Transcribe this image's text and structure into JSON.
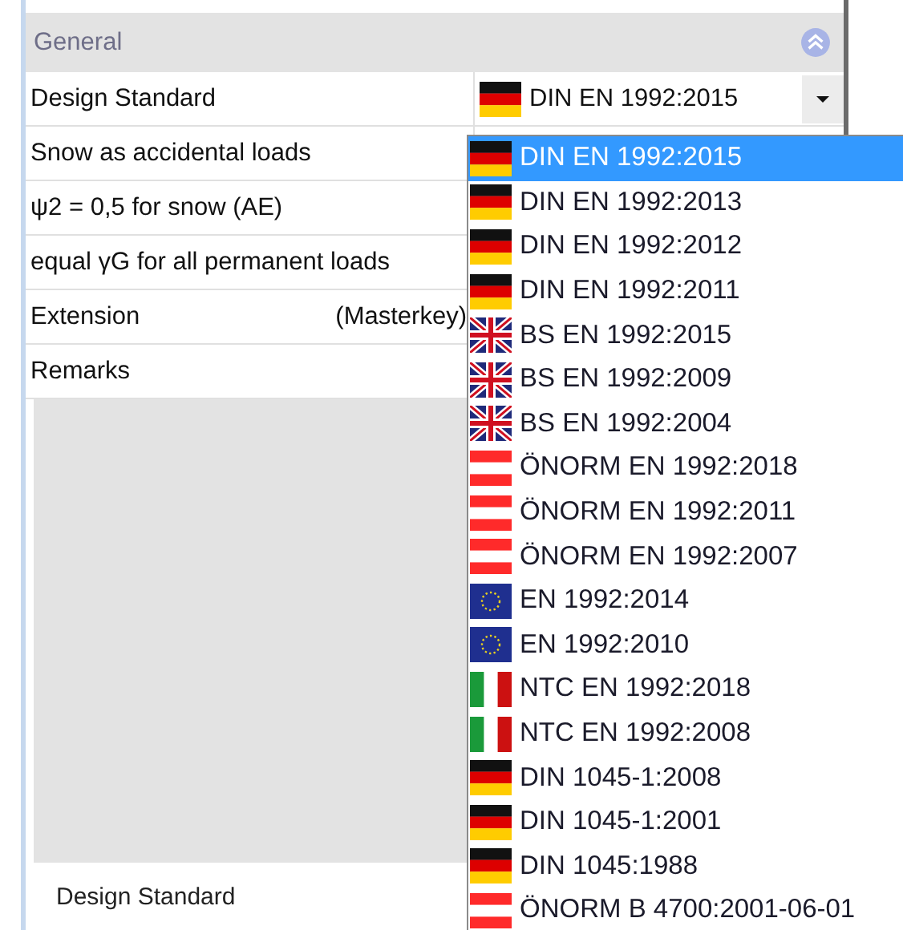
{
  "panel": {
    "section": {
      "title": "General",
      "expanded": true
    },
    "rows": [
      {
        "label": "Design Standard",
        "value": {
          "kind": "de",
          "text": "DIN EN 1992:2015"
        }
      },
      {
        "label": "Snow as accidental loads"
      },
      {
        "label": "ψ2 = 0,5 for snow (AE)"
      },
      {
        "label": "equal γG for all permanent loads"
      },
      {
        "label": "Extension",
        "note": "(Masterkey)"
      },
      {
        "label": "Remarks"
      }
    ]
  },
  "dropdown": {
    "items": [
      {
        "kind": "de",
        "text": "DIN EN 1992:2015",
        "selected": true
      },
      {
        "kind": "de",
        "text": "DIN EN 1992:2013",
        "selected": false
      },
      {
        "kind": "de",
        "text": "DIN EN 1992:2012",
        "selected": false
      },
      {
        "kind": "de",
        "text": "DIN EN 1992:2011",
        "selected": false
      },
      {
        "kind": "gb",
        "text": "BS EN 1992:2015",
        "selected": false
      },
      {
        "kind": "gb",
        "text": "BS EN 1992:2009",
        "selected": false
      },
      {
        "kind": "gb",
        "text": "BS EN 1992:2004",
        "selected": false
      },
      {
        "kind": "at",
        "text": "ÖNORM EN 1992:2018",
        "selected": false
      },
      {
        "kind": "at",
        "text": "ÖNORM EN 1992:2011",
        "selected": false
      },
      {
        "kind": "at",
        "text": "ÖNORM EN 1992:2007",
        "selected": false
      },
      {
        "kind": "eu",
        "text": "EN 1992:2014",
        "selected": false
      },
      {
        "kind": "eu",
        "text": "EN 1992:2010",
        "selected": false
      },
      {
        "kind": "it",
        "text": "NTC EN 1992:2018",
        "selected": false
      },
      {
        "kind": "it",
        "text": "NTC EN 1992:2008",
        "selected": false
      },
      {
        "kind": "de",
        "text": "DIN 1045-1:2008",
        "selected": false
      },
      {
        "kind": "de",
        "text": "DIN 1045-1:2001",
        "selected": false
      },
      {
        "kind": "de",
        "text": "DIN 1045:1988",
        "selected": false
      },
      {
        "kind": "at",
        "text": "ÖNORM B 4700:2001-06-01",
        "selected": false
      }
    ]
  },
  "description": {
    "title": "Design Standard"
  }
}
